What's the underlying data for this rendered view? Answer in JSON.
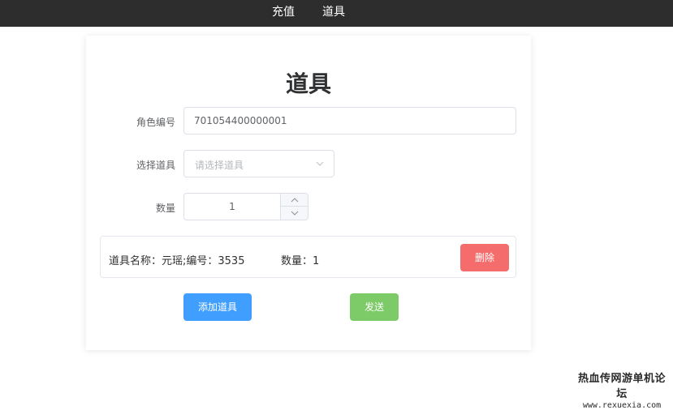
{
  "nav": {
    "items": [
      {
        "label": "充值"
      },
      {
        "label": "道具"
      }
    ]
  },
  "form": {
    "title": "道具",
    "role_id": {
      "label": "角色编号",
      "value": "701054400000001"
    },
    "item_select": {
      "label": "选择道具",
      "placeholder": "请选择道具"
    },
    "quantity": {
      "label": "数量",
      "value": "1"
    }
  },
  "items_list": [
    {
      "name_text": "道具名称：元瑶;编号：3535",
      "qty_text": "数量：1",
      "delete_label": "删除"
    }
  ],
  "actions": {
    "add_label": "添加道具",
    "send_label": "发送"
  },
  "watermark": {
    "line1": "热血传网游单机论坛",
    "line2": "www.rexuexia.com"
  },
  "colors": {
    "topbar": "#2d2d2d",
    "primary": "#409eff",
    "success": "#7dcb68",
    "danger": "#f56c6c"
  }
}
